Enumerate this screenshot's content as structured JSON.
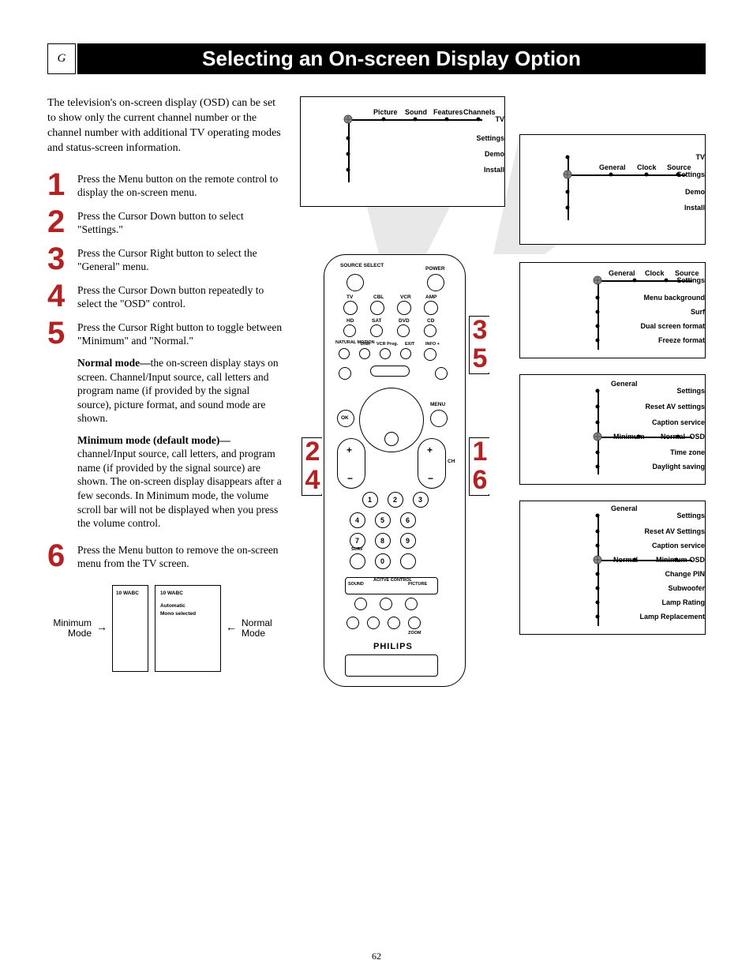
{
  "header": {
    "g": "G",
    "title": "Selecting an On-screen Display Option"
  },
  "intro": "The television's on-screen display (OSD) can be set to show only the current channel number or the channel number with additional TV operating modes and status-screen information.",
  "steps": {
    "s1": {
      "n": "1",
      "t": "Press the Menu button on the remote control to display the on-screen menu."
    },
    "s2": {
      "n": "2",
      "t": "Press the Cursor Down button to select \"Settings.\""
    },
    "s3": {
      "n": "3",
      "t": "Press the Cursor Right button to select the \"General\" menu."
    },
    "s4": {
      "n": "4",
      "t": "Press the Cursor Down button repeatedly to select the \"OSD\" control."
    },
    "s5": {
      "n": "5",
      "t": "Press the Cursor Right button to toggle between \"Minimum\" and \"Normal.\""
    },
    "s6": {
      "n": "6",
      "t": "Press the Menu button to remove the on-screen menu from the TV screen."
    }
  },
  "para_normal_lead": "Normal mode—",
  "para_normal": "the on-screen display stays on screen. Channel/Input source, call letters and program name (if provided by the signal source), picture format, and sound mode are shown.",
  "para_min_lead": "Minimum mode (default mode)—",
  "para_min": "channel/Input source, call letters, and program name (if provided by the signal source) are shown. The on-screen display disappears after a few seconds. In Minimum mode, the volume scroll bar will not be displayed when you press the volume control.",
  "menus": {
    "m1": {
      "left": [
        "TV",
        "Settings",
        "Demo",
        "Install"
      ],
      "top": [
        "Picture",
        "Sound",
        "Features",
        "Channels"
      ]
    },
    "m2": {
      "left": [
        "TV",
        "Settings",
        "Demo",
        "Install"
      ],
      "top": [
        "General",
        "Clock",
        "Source"
      ]
    },
    "m3": {
      "left": [
        "Settings",
        "Menu background",
        "Surf",
        "Dual screen format",
        "Freeze format"
      ],
      "top": [
        "General",
        "Clock",
        "Source"
      ]
    },
    "m4": {
      "left": [
        "Settings",
        "Reset AV settings",
        "Caption service",
        "OSD",
        "Time zone",
        "Daylight saving"
      ],
      "top": [
        "General"
      ],
      "right": [
        "Minimum",
        "Normal"
      ]
    },
    "m5": {
      "left": [
        "Settings",
        "Reset AV Settings",
        "Caption service",
        "OSD",
        "Change PIN",
        "Subwoofer",
        "Lamp Rating",
        "Lamp Replacement"
      ],
      "top": [
        "General"
      ],
      "right": [
        "Normal",
        "Minimum"
      ]
    }
  },
  "remote": {
    "row1": [
      "SOURCE SELECT",
      "POWER"
    ],
    "row2": [
      "TV",
      "CBL",
      "VCR",
      "AMP"
    ],
    "row3": [
      "HD",
      "SAT",
      "DVD",
      "CD"
    ],
    "row4": [
      "NATURAL MOTION",
      "DNR",
      "VCR Prog.",
      "EXIT",
      "INFO +"
    ],
    "menu": "MENU",
    "ok": "OK",
    "ch": "CH",
    "nums": [
      "1",
      "2",
      "3",
      "4",
      "5",
      "6",
      "7",
      "8",
      "9",
      "0"
    ],
    "surf": "SURF",
    "bottom_row1": [
      "SOUND",
      "ACITVE CONTROL",
      "PICTURE"
    ],
    "zoom": "ZOOM",
    "brand": "PHILIPS"
  },
  "callouts": {
    "c1": "1",
    "c2": "2",
    "c3": "3",
    "c4": "4",
    "c5": "5",
    "c6": "6"
  },
  "bottom": {
    "min_label": "Minimum Mode",
    "normal_label": "Normal Mode",
    "ch": "10  WABC",
    "auto": "Automatic",
    "mono": "Mono selected"
  },
  "page_number": "62"
}
